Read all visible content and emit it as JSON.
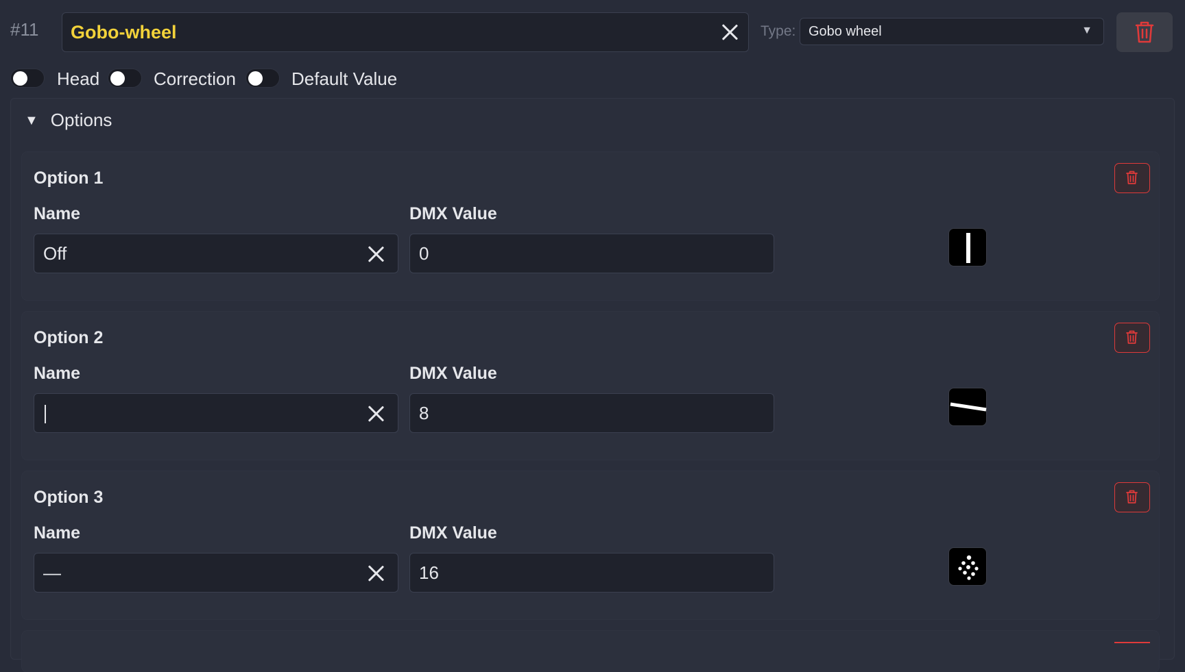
{
  "header": {
    "channel_number": "#11",
    "channel_name": "Gobo-wheel",
    "type_label": "Type:",
    "type_value": "Gobo wheel",
    "type_arrow": "▼",
    "delete_icon": "trash-icon"
  },
  "toggles": [
    {
      "label": "Head",
      "on": false
    },
    {
      "label": "Correction",
      "on": false
    },
    {
      "label": "Default Value",
      "on": false
    }
  ],
  "options": {
    "section_label": "Options",
    "collapse_glyph": "▼",
    "items": [
      {
        "title": "Option 1",
        "name_label": "Name",
        "name_value": "Off",
        "dmx_label": "DMX Value",
        "dmx_value": "0",
        "gobo_icon": "vertical-line-gobo-icon"
      },
      {
        "title": "Option 2",
        "name_label": "Name",
        "name_value": "",
        "dmx_label": "DMX Value",
        "dmx_value": "8",
        "gobo_icon": "diagonal-line-gobo-icon"
      },
      {
        "title": "Option 3",
        "name_label": "Name",
        "name_value": "—",
        "dmx_label": "DMX Value",
        "dmx_value": "16",
        "gobo_icon": "dots-gobo-icon"
      }
    ]
  },
  "colors": {
    "background": "#282c39",
    "accent_name": "#f2d23a",
    "danger": "#e03a3a"
  }
}
